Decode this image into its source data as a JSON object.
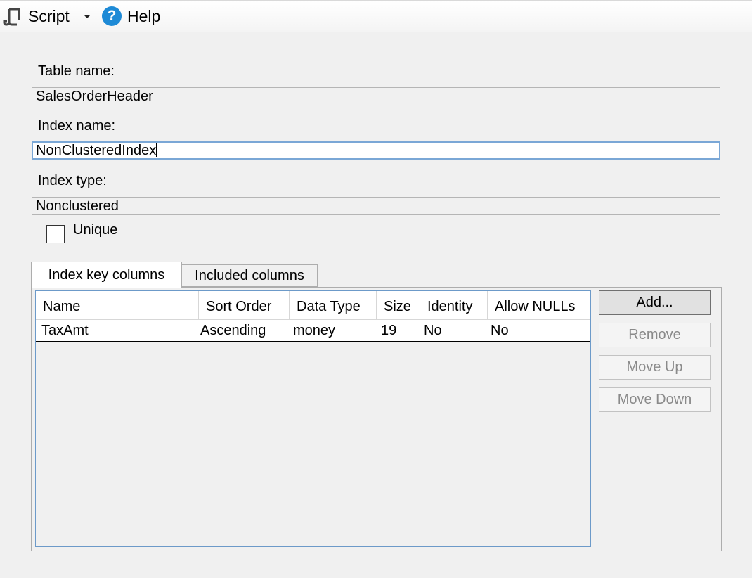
{
  "toolbar": {
    "script_label": "Script",
    "help_label": "Help"
  },
  "form": {
    "table_name_label": "Table name:",
    "table_name_value": "SalesOrderHeader",
    "index_name_label": "Index name:",
    "index_name_value": "NonClusteredIndex",
    "index_type_label": "Index type:",
    "index_type_value": "Nonclustered",
    "unique_label": "Unique"
  },
  "tabs": [
    {
      "label": "Index key columns"
    },
    {
      "label": "Included columns"
    }
  ],
  "grid": {
    "headers": [
      "Name",
      "Sort Order",
      "Data Type",
      "Size",
      "Identity",
      "Allow NULLs"
    ],
    "rows": [
      [
        "TaxAmt",
        "Ascending",
        "money",
        "19",
        "No",
        "No"
      ]
    ]
  },
  "buttons": {
    "add": "Add...",
    "remove": "Remove",
    "move_up": "Move Up",
    "move_down": "Move Down"
  }
}
